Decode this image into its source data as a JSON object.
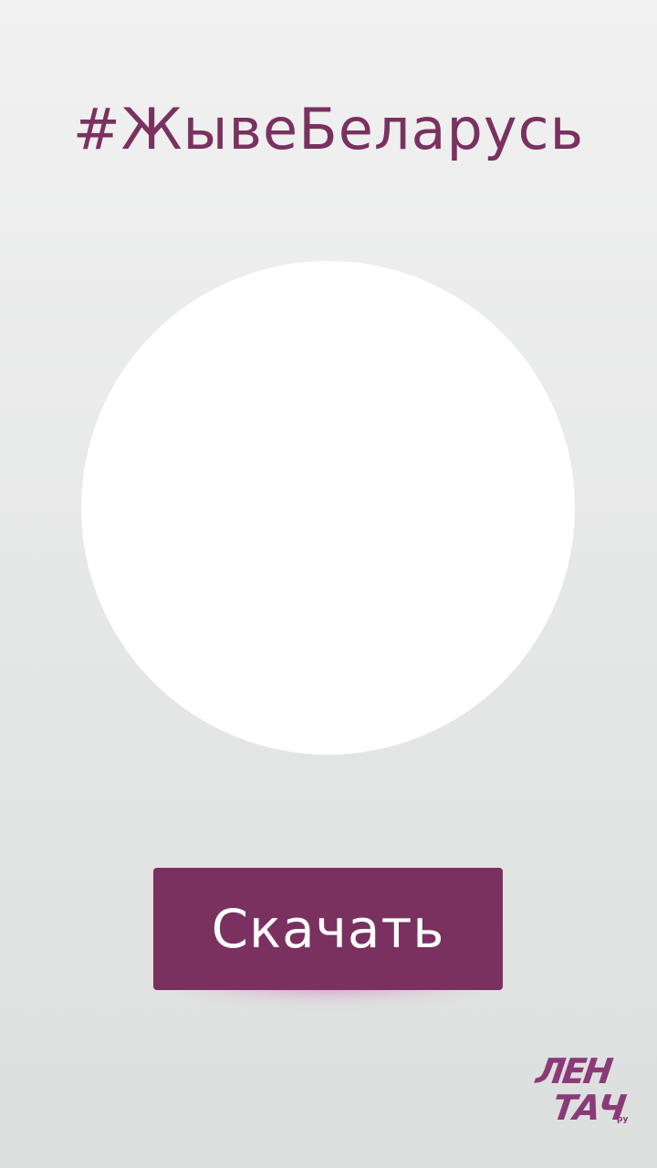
{
  "header": {
    "hashtag": "#ЖывеБеларусь"
  },
  "avatar": {
    "placeholder_color": "#ffffff"
  },
  "actions": {
    "download_label": "Скачать"
  },
  "logo": {
    "line1": "ЛЕН",
    "line2": "ТАЧ",
    "suffix": "ру"
  },
  "colors": {
    "accent": "#7a3160",
    "logo": "#8b3a78",
    "background_top": "#f1f1f1",
    "background_bottom": "#dcdfde",
    "button_glow": "#cd46aa"
  }
}
